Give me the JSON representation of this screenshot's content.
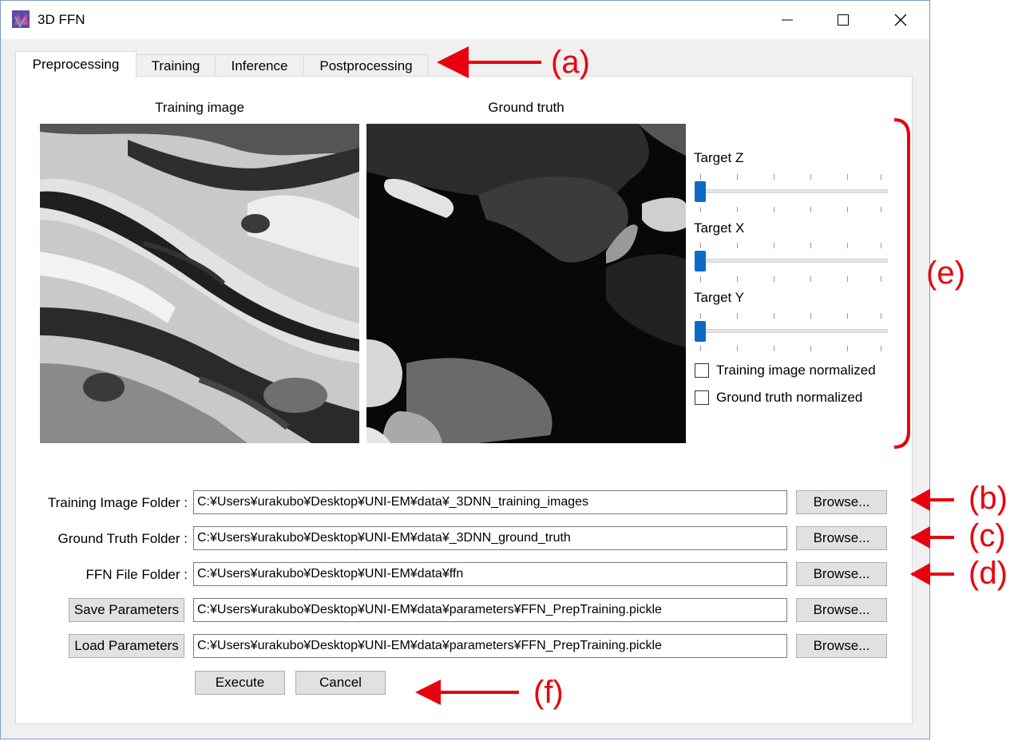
{
  "window": {
    "title": "3D FFN",
    "controls": {
      "minimize": "—",
      "maximize": "☐",
      "close": "✕"
    }
  },
  "tabs": [
    "Preprocessing",
    "Training",
    "Inference",
    "Postprocessing"
  ],
  "images": {
    "training_caption": "Training image",
    "ground_truth_caption": "Ground truth"
  },
  "sliders": [
    {
      "label": "Target Z",
      "value_fraction": 0.0
    },
    {
      "label": "Target X",
      "value_fraction": 0.0
    },
    {
      "label": "Target Y",
      "value_fraction": 0.0
    }
  ],
  "checkboxes": [
    {
      "label": "Training image normalized",
      "checked": false
    },
    {
      "label": "Ground truth normalized",
      "checked": false
    }
  ],
  "rows": [
    {
      "label": "Training Image Folder :",
      "value": "C:¥Users¥urakubo¥Desktop¥UNI-EM¥data¥_3DNN_training_images",
      "browse": "Browse..."
    },
    {
      "label": "Ground Truth Folder :",
      "value": "C:¥Users¥urakubo¥Desktop¥UNI-EM¥data¥_3DNN_ground_truth",
      "browse": "Browse..."
    },
    {
      "label": "FFN File Folder :",
      "value": "C:¥Users¥urakubo¥Desktop¥UNI-EM¥data¥ffn",
      "browse": "Browse..."
    },
    {
      "label": "Save Parameters",
      "value": "C:¥Users¥urakubo¥Desktop¥UNI-EM¥data¥parameters¥FFN_PrepTraining.pickle",
      "browse": "Browse..."
    },
    {
      "label": "Load Parameters",
      "value": "C:¥Users¥urakubo¥Desktop¥UNI-EM¥data¥parameters¥FFN_PrepTraining.pickle",
      "browse": "Browse..."
    }
  ],
  "actions": {
    "execute": "Execute",
    "cancel": "Cancel"
  },
  "annotations": {
    "a": "(a)",
    "b": "(b)",
    "c": "(c)",
    "d": "(d)",
    "e": "(e)",
    "f": "(f)"
  },
  "colors": {
    "accent": "#0a6cc6",
    "annotation": "#e8000f"
  }
}
